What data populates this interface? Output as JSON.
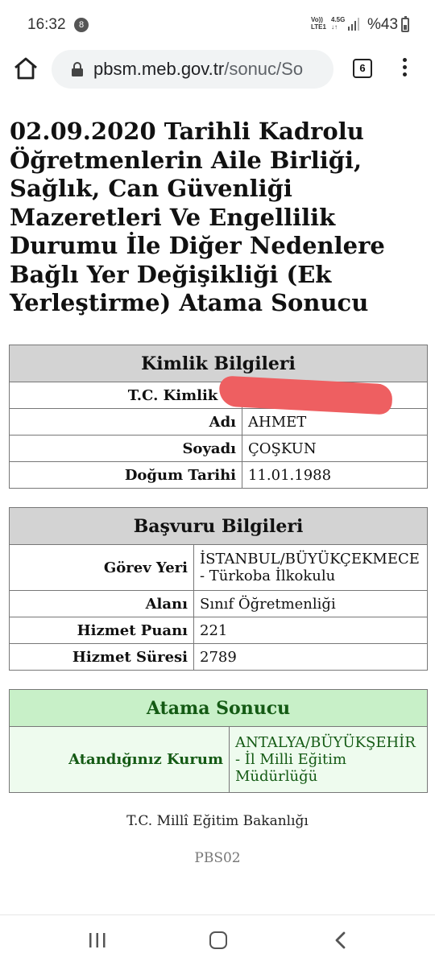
{
  "status_bar": {
    "time": "16:32",
    "notification_count": "8",
    "network_top": "Vo))",
    "network_bottom": "LTE1",
    "network_gen": "4.5G",
    "battery": "%43"
  },
  "browser": {
    "url_host": "pbsm.meb.gov.tr",
    "url_path": "/sonuc/So",
    "tab_count": "6"
  },
  "page": {
    "title": "02.09.2020 Tarihli Kadrolu Öğretmenlerin Aile Birliği, Sağlık, Can Güvenliği Mazeretleri Ve Engellilik Durumu İle Diğer Nedenlere Bağlı Yer Değişikliği (Ek Yerleştirme) Atama Sonucu"
  },
  "kimlik": {
    "header": "Kimlik Bilgileri",
    "rows": [
      {
        "label": "T.C. Kimlik N",
        "value": ""
      },
      {
        "label": "Adı",
        "value": "AHMET"
      },
      {
        "label": "Soyadı",
        "value": "ÇOŞKUN"
      },
      {
        "label": "Doğum Tarihi",
        "value": "11.01.1988"
      }
    ]
  },
  "basvuru": {
    "header": "Başvuru Bilgileri",
    "rows": [
      {
        "label": "Görev Yeri",
        "value": "İSTANBUL/BÜYÜKÇEKMECE - Türkoba İlkokulu"
      },
      {
        "label": "Alanı",
        "value": "Sınıf Öğretmenliği"
      },
      {
        "label": "Hizmet Puanı",
        "value": "221"
      },
      {
        "label": "Hizmet Süresi",
        "value": "2789"
      }
    ]
  },
  "atama": {
    "header": "Atama Sonucu",
    "label": "Atandığınız Kurum",
    "value": "ANTALYA/BÜYÜKŞEHİR - İl Milli Eğitim Müdürlüğü"
  },
  "footer": {
    "ministry": "T.C. Millî Eğitim Bakanlığı",
    "code": "PBS02"
  },
  "colors": {
    "header_gray": "#d3d3d3",
    "result_header_green": "#c8f0c8",
    "result_text_green": "#145a14",
    "redaction_red": "#ee5f61"
  }
}
